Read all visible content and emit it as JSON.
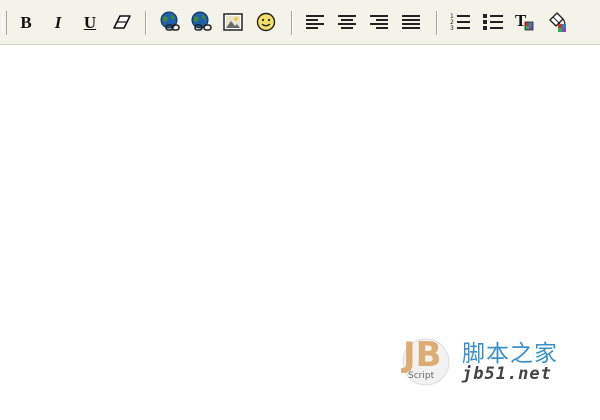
{
  "toolbar": {
    "buttons": [
      {
        "name": "bold",
        "label": "B"
      },
      {
        "name": "italic",
        "label": "I"
      },
      {
        "name": "underline",
        "label": "U"
      },
      {
        "name": "eraser",
        "icon": "eraser-icon"
      },
      {
        "name": "insert-link",
        "icon": "globe-link-icon"
      },
      {
        "name": "remove-link",
        "icon": "globe-unlink-icon"
      },
      {
        "name": "insert-image",
        "icon": "picture-icon"
      },
      {
        "name": "insert-smiley",
        "icon": "smiley-icon"
      },
      {
        "name": "align-left",
        "icon": "align-left-icon"
      },
      {
        "name": "align-center",
        "icon": "align-center-icon"
      },
      {
        "name": "align-right",
        "icon": "align-right-icon"
      },
      {
        "name": "justify",
        "icon": "justify-icon"
      },
      {
        "name": "ordered-list",
        "icon": "numbered-list-icon"
      },
      {
        "name": "unordered-list",
        "icon": "bullet-list-icon"
      },
      {
        "name": "text-color",
        "icon": "text-color-icon"
      },
      {
        "name": "background-color",
        "icon": "paint-bucket-icon"
      }
    ],
    "ordered_list_digits": [
      "1",
      "2",
      "3"
    ],
    "text_color_letter": "T"
  },
  "editor": {
    "content": ""
  },
  "watermark": {
    "logo_text": "JB",
    "logo_sub": "Script",
    "site_name_cn": "脚本之家",
    "url": "jb51.net"
  },
  "colors": {
    "toolbar_bg": "#f4f3ea",
    "link_blue": "#1f5fa8",
    "watermark_blue": "#3a91c8",
    "logo_orange": "#d9a05b"
  }
}
